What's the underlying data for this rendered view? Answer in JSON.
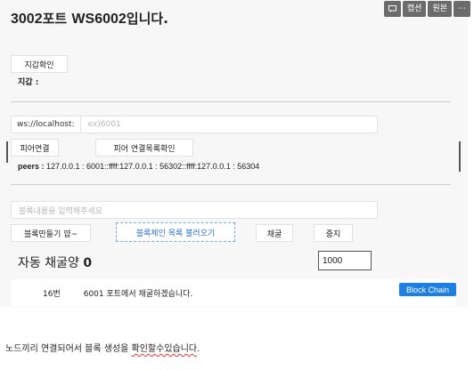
{
  "header": {
    "title_num": "3002",
    "title_mid": "포트 ",
    "title_ws": "WS6002",
    "title_end": "입니다."
  },
  "topbar": {
    "caption": "캡션",
    "original": "원본",
    "more": "⋯"
  },
  "wallet": {
    "check_button": "지갑확인",
    "label": "지갑 :"
  },
  "connect": {
    "prefix": "ws://localhost:",
    "placeholder": "ex)6001",
    "connect_button": "피어연결",
    "list_button": "피어 연결목록확인",
    "peers_label": "peers :",
    "peers_value": " 127.0.0.1 : 6001::ffff:127.0.0.1 : 56302::ffff:127.0.0.1 : 56304"
  },
  "block": {
    "placeholder": "블록내용을 입력해주세요",
    "make_button": "블록만들기 얍~",
    "load_button": "블록체인 목록 불러오기",
    "mine_button": "채굴",
    "stop_button": "중지"
  },
  "auto_mine": {
    "label": "자동 채굴양",
    "count": "0",
    "input_value": "1000"
  },
  "log": {
    "index": "16번",
    "message": "6001 포트에서 채굴하겠습니다.",
    "chain_button": "Block Chain"
  },
  "footer": {
    "pre": "노드끼리 연결되어서 블록 생성을 ",
    "underlined": "확인할수있습니다",
    "post": "."
  }
}
